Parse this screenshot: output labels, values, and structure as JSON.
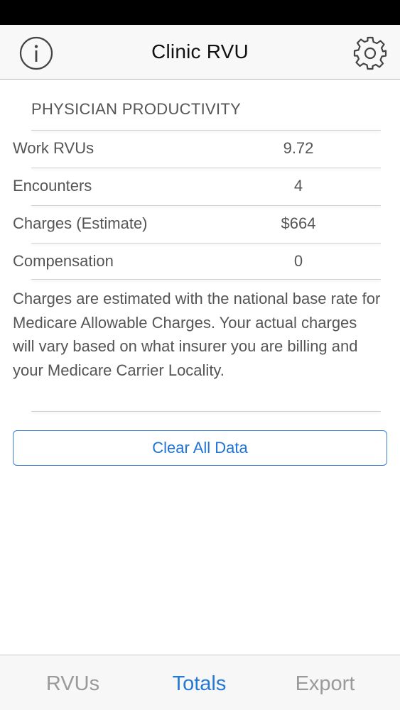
{
  "header": {
    "title": "Clinic RVU",
    "left_icon": "info-icon",
    "right_icon": "gear-icon"
  },
  "section": {
    "title": "PHYSICIAN PRODUCTIVITY",
    "rows": [
      {
        "label": "Work RVUs",
        "value": "9.72"
      },
      {
        "label": "Encounters",
        "value": "4"
      },
      {
        "label": "Charges (Estimate)",
        "value": "$664"
      },
      {
        "label": "Compensation",
        "value": "0"
      }
    ],
    "note": "Charges are estimated with the national base rate for Medicare Allowable Charges. Your actual charges will vary based on what insurer you are billing and your Medicare Carrier Locality."
  },
  "actions": {
    "clear_label": "Clear All Data"
  },
  "tabs": [
    {
      "label": "RVUs",
      "active": false
    },
    {
      "label": "Totals",
      "active": true
    },
    {
      "label": "Export",
      "active": false
    }
  ],
  "colors": {
    "accent": "#2478d6",
    "text": "#555555",
    "inactive_tab": "#9a9a9a"
  }
}
